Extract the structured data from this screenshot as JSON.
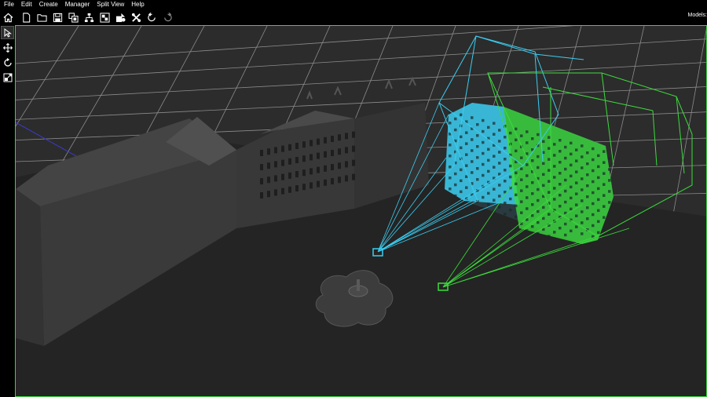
{
  "menu": {
    "items": [
      "File",
      "Edit",
      "Create",
      "Manager",
      "Split View",
      "Help"
    ]
  },
  "toolbar": {
    "buttons": [
      "home-icon",
      "new-file-icon",
      "open-folder-icon",
      "save-icon",
      "copy-icon",
      "hierarchy-icon",
      "scene-icon",
      "shapes-icon",
      "tools-icon",
      "undo-icon",
      "redo-icon"
    ],
    "right_label": "Models:"
  },
  "left_tools": [
    "select-arrow-icon",
    "move-icon",
    "rotate-icon",
    "scale-icon"
  ],
  "colors": {
    "background": "#000000",
    "viewport": "#2c2c2c",
    "grid": "#9a9a9a",
    "viewport_border": "#3cd23c",
    "camera_cyan": "#3ccdf0",
    "camera_green": "#3cdc3c",
    "building": "#3a3a3a"
  }
}
